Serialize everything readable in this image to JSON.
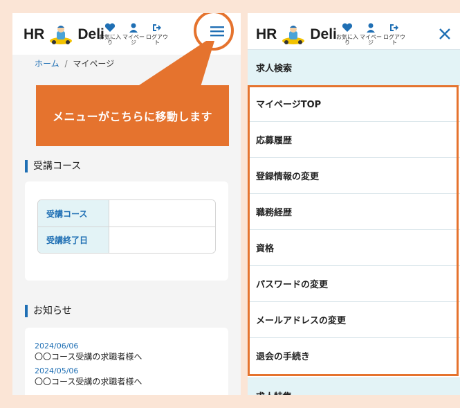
{
  "brand": {
    "prefix": "HR",
    "suffix": "Deli"
  },
  "nav": {
    "favorites_label": "お気に入り",
    "mypage_label": "マイページ",
    "logout_label": "ログアウト"
  },
  "breadcrumb": {
    "home": "ホーム",
    "separator": "/",
    "current": "マイページ"
  },
  "callout": {
    "text": "メニューがこちらに移動します"
  },
  "course_section": {
    "title": "受講コース",
    "rows": [
      {
        "label": "受講コース",
        "value": ""
      },
      {
        "label": "受講終了日",
        "value": ""
      }
    ]
  },
  "news_section": {
    "title": "お知らせ",
    "items": [
      {
        "date": "2024/06/06",
        "text": "〇〇コース受講の求職者様へ"
      },
      {
        "date": "2024/05/06",
        "text": "〇〇コース受講の求職者様へ"
      }
    ]
  },
  "menu": {
    "top_item": "求人検索",
    "items": [
      "マイページTOP",
      "応募履歴",
      "登録情報の変更",
      "職務経歴",
      "資格",
      "パスワードの変更",
      "メールアドレスの変更",
      "退会の手続き"
    ],
    "bottom_item": "求人特集"
  },
  "colors": {
    "accent_orange": "#e5732e",
    "brand_blue": "#1f6fb4",
    "light_teal": "#e3f3f6",
    "page_bg": "#fbe5d6"
  }
}
